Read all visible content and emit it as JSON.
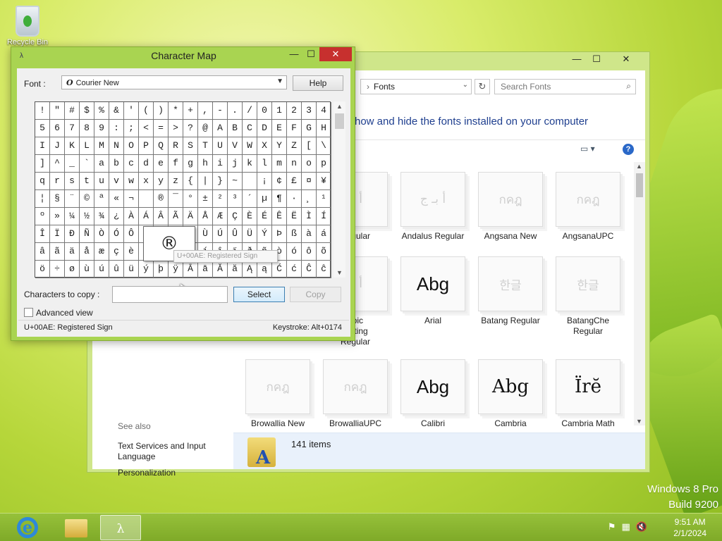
{
  "desktop": {
    "recycle_bin_label": "Recycle Bin",
    "os_watermark": {
      "line1": "Windows 8 Pro",
      "line2": "Build 9200"
    }
  },
  "explorer": {
    "window_controls": {
      "minimize": "—",
      "maximize": "☐",
      "close": "✕"
    },
    "address_path": "Fonts",
    "search_placeholder": "Search Fonts",
    "heading": "how and hide the fonts installed on your computer",
    "fonts": [
      {
        "name": "Regular",
        "sample": "أ بـ",
        "style": "light"
      },
      {
        "name": "Andalus Regular",
        "sample": "أ بـ ج",
        "style": "light"
      },
      {
        "name": "Angsana New",
        "sample": "กคฎ",
        "style": "light"
      },
      {
        "name": "AngsanaUPC",
        "sample": "กคฎ",
        "style": "light"
      },
      {
        "name": "abic\nsetting\nRegular",
        "sample": "أ بـ",
        "style": "light"
      },
      {
        "name": "Arial",
        "sample": "Abg",
        "style": "dark"
      },
      {
        "name": "Batang Regular",
        "sample": "한글",
        "style": "light"
      },
      {
        "name": "BatangChe\nRegular",
        "sample": "한글",
        "style": "light"
      },
      {
        "name": "Browallia New",
        "sample": "กคฎ",
        "style": "light"
      },
      {
        "name": "BrowalliaUPC",
        "sample": "กคฎ",
        "style": "light"
      },
      {
        "name": "Calibri",
        "sample": "Abg",
        "style": "dark"
      },
      {
        "name": "Cambria",
        "sample": "Abg",
        "style": "dark-serif"
      },
      {
        "name": "Cambria Math",
        "sample": "Ïrĕ",
        "style": "dark-serif"
      }
    ],
    "see_also": {
      "heading": "See also",
      "links": [
        "Text Services and Input Language",
        "Personalization"
      ]
    },
    "item_count": "141 items"
  },
  "charmap": {
    "title": "Character Map",
    "window_controls": {
      "minimize": "—",
      "maximize": "☐",
      "close": "✕"
    },
    "font_label": "Font :",
    "font_icon": "O",
    "font_value": "Courier New",
    "help_label": "Help",
    "chars": [
      "!",
      "\"",
      "#",
      "$",
      "%",
      "&",
      "'",
      "(",
      ")",
      "*",
      "+",
      ",",
      "-",
      ".",
      "/",
      "0",
      "1",
      "2",
      "3",
      "4",
      "5",
      "6",
      "7",
      "8",
      "9",
      ":",
      ";",
      "<",
      "=",
      ">",
      "?",
      "@",
      "A",
      "B",
      "C",
      "D",
      "E",
      "F",
      "G",
      "H",
      "I",
      "J",
      "K",
      "L",
      "M",
      "N",
      "O",
      "P",
      "Q",
      "R",
      "S",
      "T",
      "U",
      "V",
      "W",
      "X",
      "Y",
      "Z",
      "[",
      "\\",
      "]",
      "^",
      "_",
      "`",
      "a",
      "b",
      "c",
      "d",
      "e",
      "f",
      "g",
      "h",
      "i",
      "j",
      "k",
      "l",
      "m",
      "n",
      "o",
      "p",
      "q",
      "r",
      "s",
      "t",
      "u",
      "v",
      "w",
      "x",
      "y",
      "z",
      "{",
      "|",
      "}",
      "~",
      "",
      "¡",
      "¢",
      "£",
      "¤",
      "¥",
      "¦",
      "§",
      "¨",
      "©",
      "ª",
      "«",
      "¬",
      "",
      "®",
      "¯",
      "°",
      "±",
      "²",
      "³",
      "´",
      "µ",
      "¶",
      "·",
      "¸",
      "¹",
      "º",
      "»",
      "¼",
      "½",
      "¾",
      "¿",
      "À",
      "Á",
      "Â",
      "Ã",
      "Ä",
      "Å",
      "Æ",
      "Ç",
      "È",
      "É",
      "Ê",
      "Ë",
      "Ì",
      "Í",
      "Î",
      "Ï",
      "Ð",
      "Ñ",
      "Ò",
      "Ó",
      "Ô",
      "Õ",
      "Ö",
      "×",
      "Ø",
      "Ù",
      "Ú",
      "Û",
      "Ü",
      "Ý",
      "Þ",
      "ß",
      "à",
      "á",
      "â",
      "ã",
      "ä",
      "å",
      "æ",
      "ç",
      "è",
      "é",
      "ê",
      "ë",
      "ì",
      "í",
      "î",
      "ï",
      "ð",
      "ñ",
      "ò",
      "ó",
      "ô",
      "õ",
      "ö",
      "÷",
      "ø",
      "ù",
      "ú",
      "û",
      "ü",
      "ý",
      "þ",
      "ÿ",
      "Ā",
      "ā",
      "Ă",
      "ă",
      "Ą",
      "ą",
      "Ć",
      "ć",
      "Ĉ",
      "ĉ"
    ],
    "magnified_char": "®",
    "tooltip": "U+00AE: Registered Sign",
    "copy_label": "Characters to copy :",
    "copy_value": "",
    "select_label": "Select",
    "copy_button_label": "Copy",
    "advanced_view_label": "Advanced view",
    "status_left": "U+00AE: Registered Sign",
    "status_right": "Keystroke: Alt+0174"
  },
  "taskbar": {
    "clock_time": "9:51 AM",
    "clock_date": "2/1/2024"
  }
}
